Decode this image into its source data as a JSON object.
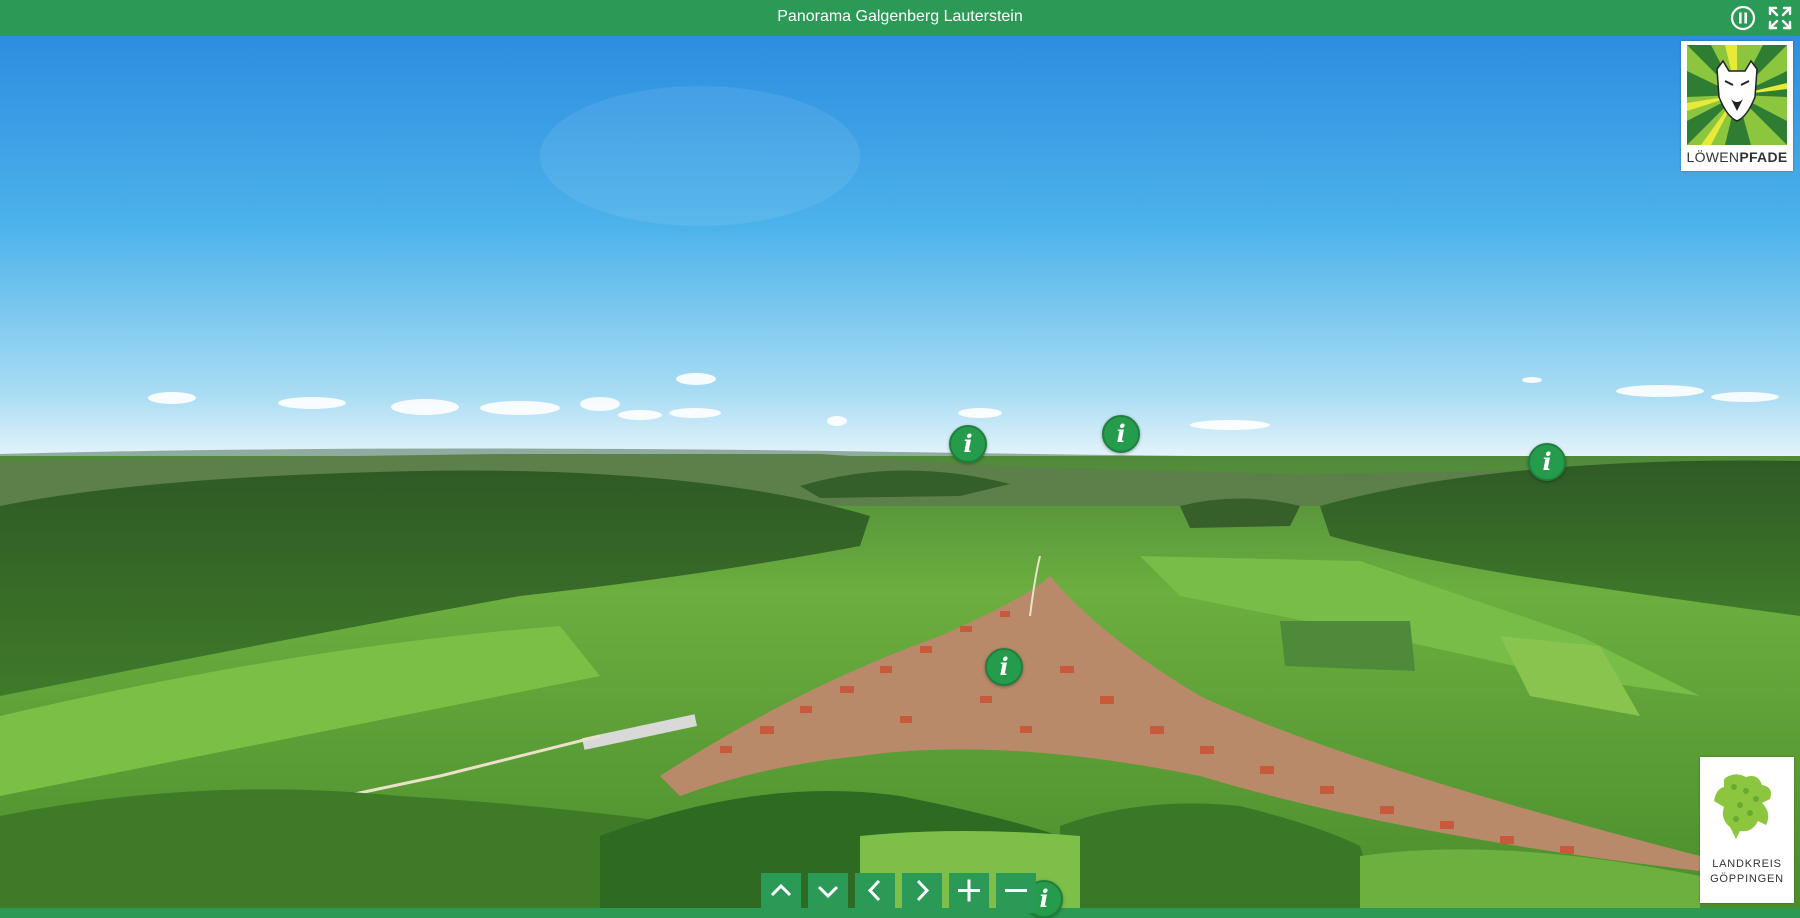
{
  "header": {
    "title": "Panorama Galgenberg Lauterstein",
    "pause_icon": "pause-circle-icon",
    "fullscreen_icon": "fullscreen-icon"
  },
  "logos": {
    "top_right": {
      "prefix": "LÖWEN",
      "suffix": "PFADE"
    },
    "bottom_right": {
      "line1": "LANDKREIS",
      "line2": "GÖPPINGEN"
    }
  },
  "hotspots": [
    {
      "label": "i"
    },
    {
      "label": "i"
    },
    {
      "label": "i"
    },
    {
      "label": "i"
    },
    {
      "label": "i"
    }
  ],
  "controls": [
    {
      "icon": "chevron-up-icon"
    },
    {
      "icon": "chevron-down-icon"
    },
    {
      "icon": "chevron-left-icon"
    },
    {
      "icon": "chevron-right-icon"
    },
    {
      "icon": "zoom-in-icon"
    },
    {
      "icon": "zoom-out-icon"
    }
  ],
  "colors": {
    "brand_green": "#2b9a56",
    "sky_top": "#2e8fe0",
    "sky_horizon": "#dff0fa"
  }
}
